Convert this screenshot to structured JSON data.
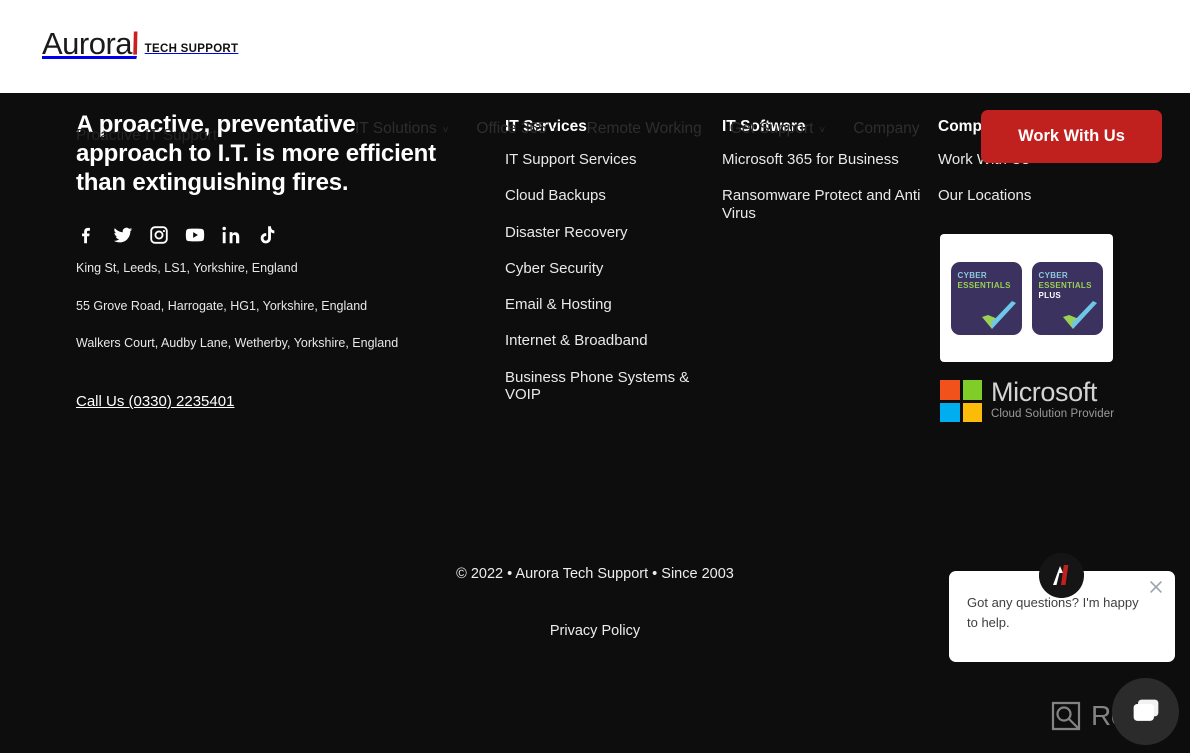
{
  "header": {
    "logo_word": "Aurora",
    "logo_slash": "\\",
    "logo_sub": "TECH SUPPORT"
  },
  "ghost_nav": {
    "items": [
      {
        "label": "IT Solutions",
        "caret": "˅"
      },
      {
        "label": "Office 365",
        "caret": "˅"
      },
      {
        "label": "Remote Working",
        "caret": ""
      },
      {
        "label": "Get Support",
        "caret": "˅"
      },
      {
        "label": "Company",
        "caret": ""
      }
    ],
    "ghost_headline": "Proactive IT Support"
  },
  "footer": {
    "headline": "A proactive, preventative approach to I.T. is more efficient than extinguishing fires.",
    "socials": [
      {
        "name": "facebook-icon",
        "label": "Facebook"
      },
      {
        "name": "twitter-icon",
        "label": "Twitter"
      },
      {
        "name": "instagram-icon",
        "label": "Instagram"
      },
      {
        "name": "youtube-icon",
        "label": "YouTube"
      },
      {
        "name": "linkedin-icon",
        "label": "LinkedIn"
      },
      {
        "name": "tiktok-icon",
        "label": "TikTok"
      }
    ],
    "addresses": [
      "King St, Leeds, LS1, Yorkshire, England",
      "55 Grove Road, Harrogate, HG1, Yorkshire, England",
      "Walkers Court, Audby Lane, Wetherby, Yorkshire, England"
    ],
    "call_us": "Call Us (0330) 2235401",
    "columns": {
      "services": {
        "title": "IT Services",
        "links": [
          "IT Support Services",
          "Cloud Backups",
          "Disaster Recovery",
          "Cyber Security",
          "Email & Hosting",
          "Internet & Broadband",
          "Business Phone Systems & VOIP"
        ]
      },
      "software": {
        "title": "IT Software",
        "links": [
          "Microsoft 365 for Business",
          "Ransomware Protect and Anti Virus"
        ]
      },
      "company": {
        "title": "Company",
        "links": [
          "Work With Us",
          "Our Locations"
        ]
      }
    },
    "work_with_us_button": "Work With Us",
    "badges": {
      "cyber_essentials": {
        "line1": "CYBER",
        "line2": "ESSENTIALS"
      },
      "cyber_essentials_plus": {
        "line1": "CYBER",
        "line2": "ESSENTIALS",
        "line3": "PLUS"
      },
      "microsoft": {
        "name": "Microsoft",
        "tagline": "Cloud Solution Provider"
      }
    },
    "copyright": "© 2022 • Aurora Tech Support • Since 2003",
    "privacy_policy": "Privacy Policy"
  },
  "chat": {
    "message": "Got any questions? I'm happy to help.",
    "close_label": "×"
  },
  "watermark": {
    "text": "Revain"
  },
  "colors": {
    "brand_red": "#c0211f",
    "page_bg": "#0d0d0d",
    "header_bg": "#ffffff"
  }
}
